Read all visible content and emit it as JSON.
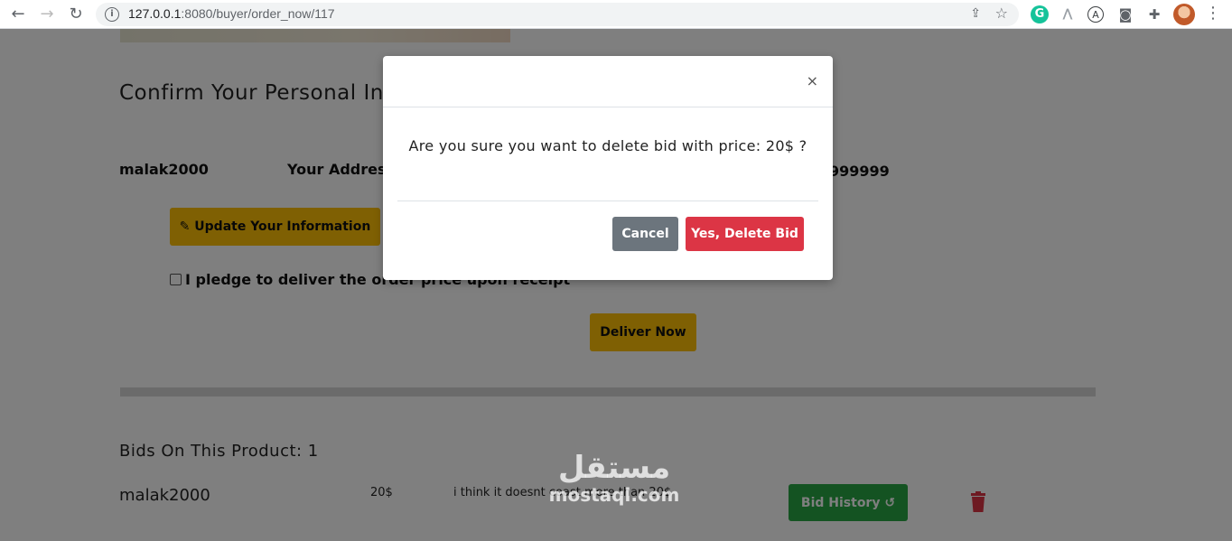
{
  "browser": {
    "url_host": "127.0.0.1",
    "url_path": ":8080/buyer/order_now/117",
    "icons": [
      "back-arrow-icon",
      "forward-arrow-icon",
      "reload-icon",
      "info-icon",
      "share-icon",
      "star-icon",
      "grammarly-icon",
      "extension-icon",
      "account-icon",
      "camera-icon",
      "puzzle-icon",
      "avatar",
      "more-menu-icon"
    ]
  },
  "page": {
    "confirm_title": "Confirm Your Personal Info",
    "username": "malak2000",
    "address_label": "Your Address",
    "phone_partial": "999999",
    "update_button": "✎ Update Your Information",
    "pledge_label": "I pledge to deliver the order price upon receipt",
    "deliver_button": "Deliver Now",
    "bids_title": "Bids On This Product: 1",
    "bids": [
      {
        "user": "malak2000",
        "price": "20$",
        "note": "i think it doesnt coast more than 20$",
        "history_button": "Bid History ↺"
      }
    ]
  },
  "modal": {
    "close_label": "×",
    "message": "Are you sure you want to delete bid with price: 20$ ?",
    "cancel_label": "Cancel",
    "delete_label": "Yes, Delete Bid"
  },
  "watermark": {
    "arabic": "مستقل",
    "latin": "mostaql.com"
  },
  "colors": {
    "warning": "#ffc107",
    "danger": "#dc3545",
    "success": "#28a745",
    "secondary": "#6c757d"
  }
}
